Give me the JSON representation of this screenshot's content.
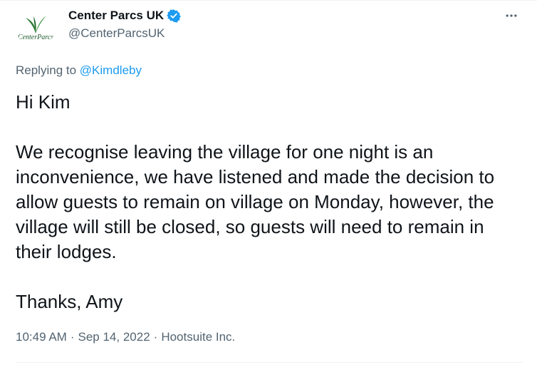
{
  "author": {
    "display_name": "Center Parcs UK",
    "handle": "@CenterParcsUK",
    "verified": true,
    "avatar_icon": "center-parcs-logo-icon",
    "avatar_text": "CenterParcs",
    "brand_color": "#2f7d32"
  },
  "reply": {
    "prefix": "Replying to",
    "mention": "@Kimdleby"
  },
  "tweet": {
    "greeting": "Hi Kim",
    "body": "We recognise leaving the village for one night is an inconvenience, we have listened and made the decision to allow guests to remain on village on Monday, however, the village will still be closed, so guests will need to remain in their lodges.",
    "signoff": "Thanks, Amy"
  },
  "meta": {
    "time": "10:49 AM",
    "separator": "·",
    "date": "Sep 14, 2022",
    "source": "Hootsuite Inc."
  },
  "colors": {
    "text": "#0f1419",
    "secondary": "#536471",
    "link": "#1d9bf0",
    "verified": "#1d9bf0"
  },
  "icons": {
    "more": "more-horizontal-icon",
    "verified": "verified-badge-icon"
  }
}
